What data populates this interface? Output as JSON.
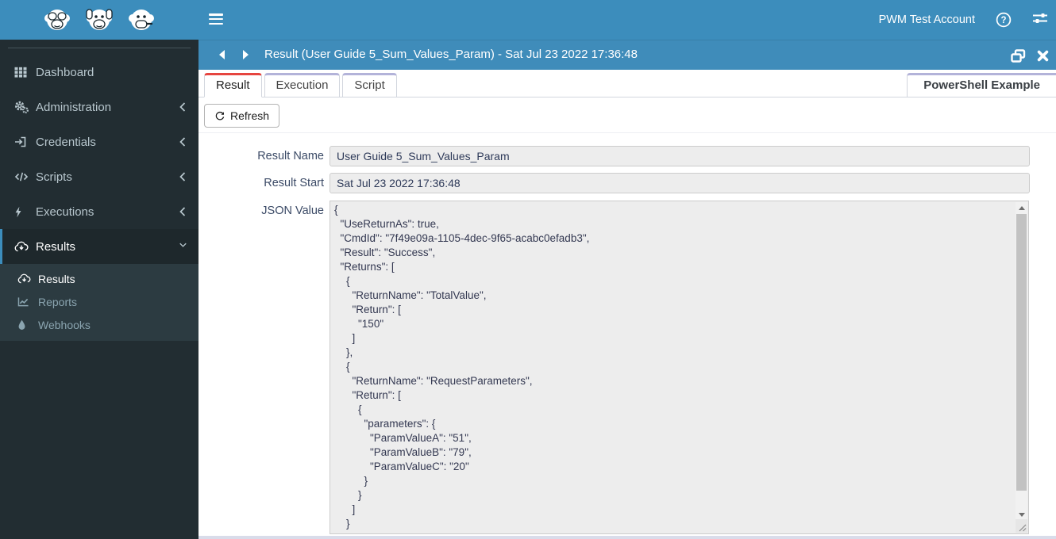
{
  "topbar": {
    "account": "PWM Test Account"
  },
  "window": {
    "title": "Result (User Guide 5_Sum_Values_Param) - Sat Jul 23 2022 17:36:48"
  },
  "sidebar": {
    "items": [
      {
        "label": "Dashboard",
        "icon": "grid-icon"
      },
      {
        "label": "Administration",
        "icon": "gears-icon"
      },
      {
        "label": "Credentials",
        "icon": "sign-in-icon"
      },
      {
        "label": "Scripts",
        "icon": "code-icon"
      },
      {
        "label": "Executions",
        "icon": "bolt-icon"
      },
      {
        "label": "Results",
        "icon": "cloud-download-icon"
      }
    ],
    "submenu": [
      {
        "label": "Results",
        "icon": "cloud-download-icon"
      },
      {
        "label": "Reports",
        "icon": "chart-line-icon"
      },
      {
        "label": "Webhooks",
        "icon": "droplet-icon"
      }
    ]
  },
  "tabs": {
    "result": "Result",
    "execution": "Execution",
    "script": "Script",
    "right": "PowerShell Example"
  },
  "toolbar": {
    "refresh": "Refresh"
  },
  "form": {
    "result_name_label": "Result Name",
    "result_name_value": "User Guide 5_Sum_Values_Param",
    "result_start_label": "Result Start",
    "result_start_label_note": "",
    "result_start_value": "Sat Jul 23 2022 17:36:48",
    "json_label": "JSON Value",
    "json_value": "{\n  \"UseReturnAs\": true,\n  \"CmdId\": \"7f49e09a-1105-4dec-9f65-acabc0efadb3\",\n  \"Result\": \"Success\",\n  \"Returns\": [\n    {\n      \"ReturnName\": \"TotalValue\",\n      \"Return\": [\n        \"150\"\n      ]\n    },\n    {\n      \"ReturnName\": \"RequestParameters\",\n      \"Return\": [\n        {\n          \"parameters\": {\n            \"ParamValueA\": \"51\",\n            \"ParamValueB\": \"79\",\n            \"ParamValueC\": \"20\"\n          }\n        }\n      ]\n    }\n  ]\n}"
  },
  "colors": {
    "header_blue": "#3c8dbc",
    "sidebar_dark": "#222d32",
    "submenu_dark": "#2c3b41",
    "active_tab_red": "#e64540",
    "inactive_tab_top": "#b3b3d9",
    "input_bg": "#ededed"
  }
}
